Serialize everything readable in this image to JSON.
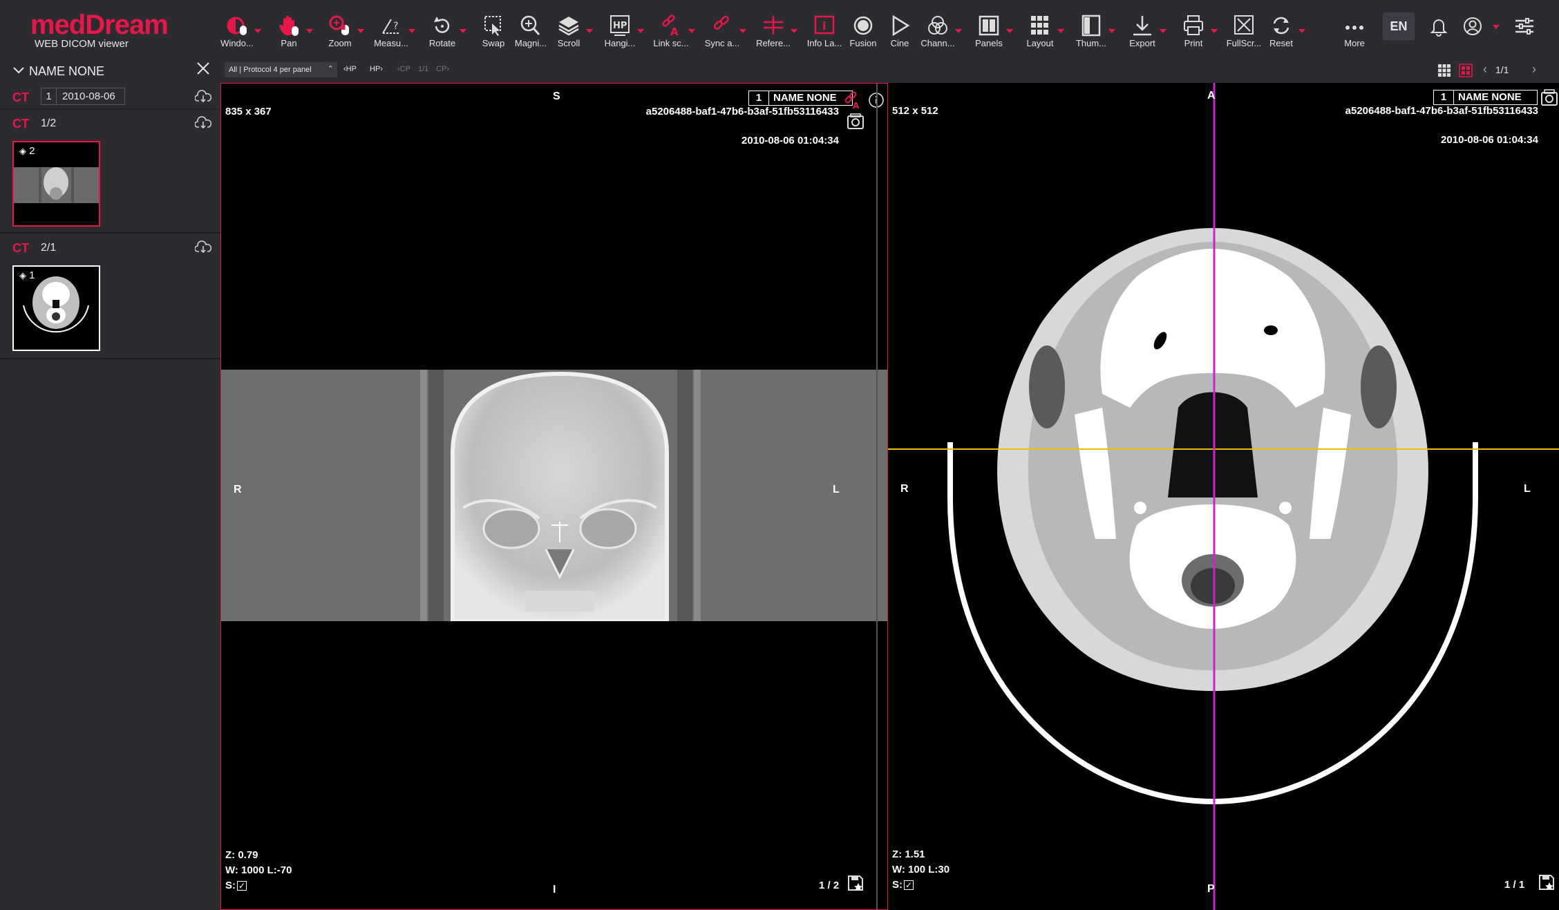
{
  "app": {
    "brand": "medDream",
    "subtitle": "WEB DICOM viewer"
  },
  "toolbar": {
    "tools": [
      {
        "label": "Windo...",
        "icon": "window-level-icon"
      },
      {
        "label": "Pan",
        "icon": "pan-hand-icon"
      },
      {
        "label": "Zoom",
        "icon": "zoom-mouse-icon"
      },
      {
        "label": "Measu...",
        "icon": "measure-icon"
      },
      {
        "label": "Rotate",
        "icon": "rotate-icon"
      },
      {
        "label": "Swap",
        "icon": "swap-icon"
      },
      {
        "label": "Magni...",
        "icon": "magnifier-icon"
      },
      {
        "label": "Scroll",
        "icon": "layers-scroll-icon"
      },
      {
        "label": "Hangi...",
        "icon": "hanging-protocol-icon"
      },
      {
        "label": "Link sc...",
        "icon": "link-scroll-icon"
      },
      {
        "label": "Sync a...",
        "icon": "sync-icon"
      },
      {
        "label": "Refere...",
        "icon": "reference-lines-icon"
      },
      {
        "label": "Info La...",
        "icon": "info-layer-icon"
      },
      {
        "label": "Fusion",
        "icon": "fusion-icon"
      },
      {
        "label": "Cine",
        "icon": "play-icon"
      },
      {
        "label": "Chann...",
        "icon": "channels-icon"
      },
      {
        "label": "Panels",
        "icon": "panels-icon"
      },
      {
        "label": "Layout",
        "icon": "layout-grid-icon"
      },
      {
        "label": "Thum...",
        "icon": "thumbnails-icon"
      },
      {
        "label": "Export",
        "icon": "download-icon"
      },
      {
        "label": "Print",
        "icon": "print-icon"
      },
      {
        "label": "FullScr...",
        "icon": "fullscreen-icon"
      },
      {
        "label": "Reset",
        "icon": "reset-icon"
      },
      {
        "label": "More",
        "icon": "more-dots-icon"
      }
    ],
    "language": "EN"
  },
  "sidebar": {
    "patient_name": "NAME NONE",
    "study": {
      "modality": "CT",
      "count": "1",
      "date": "2010-08-06"
    },
    "series": [
      {
        "modality": "CT",
        "index": "1/2",
        "thumb_count": "2"
      },
      {
        "modality": "CT",
        "index": "2/1",
        "thumb_count": "1"
      }
    ]
  },
  "subbar": {
    "protocol": "All | Protocol 4 per panel",
    "hp_prev": "HP",
    "hp_next": "HP",
    "cp_prev": "CP",
    "cp_page": "1/1",
    "cp_next": "CP",
    "page": "1/1"
  },
  "viewports": [
    {
      "dims": "835 x 367",
      "tag_num": "1",
      "tag_name": "NAME NONE",
      "uid": "a5206488-baf1-47b6-b3af-51fb53116433",
      "datetime": "2010-08-06 01:04:34",
      "orient_top": "S",
      "orient_bottom": "I",
      "orient_left": "R",
      "orient_right": "L",
      "zoom": "Z: 0.79",
      "wl": "W: 1000 L:-70",
      "sync": "S:",
      "frame": "1 / 2"
    },
    {
      "dims": "512 x 512",
      "tag_num": "1",
      "tag_name": "NAME NONE",
      "uid": "a5206488-baf1-47b6-b3af-51fb53116433",
      "datetime": "2010-08-06 01:04:34",
      "orient_top": "A",
      "orient_bottom": "P",
      "orient_left": "R",
      "orient_right": "L",
      "zoom": "Z: 1.51",
      "wl": "W: 100 L:30",
      "sync": "S:",
      "frame": "1 / 1"
    }
  ],
  "colors": {
    "accent": "#e8174a",
    "toolbar_bg": "#2b2b30",
    "reference_line_h": "#e5c100",
    "reference_line_v": "#d21fd2"
  }
}
